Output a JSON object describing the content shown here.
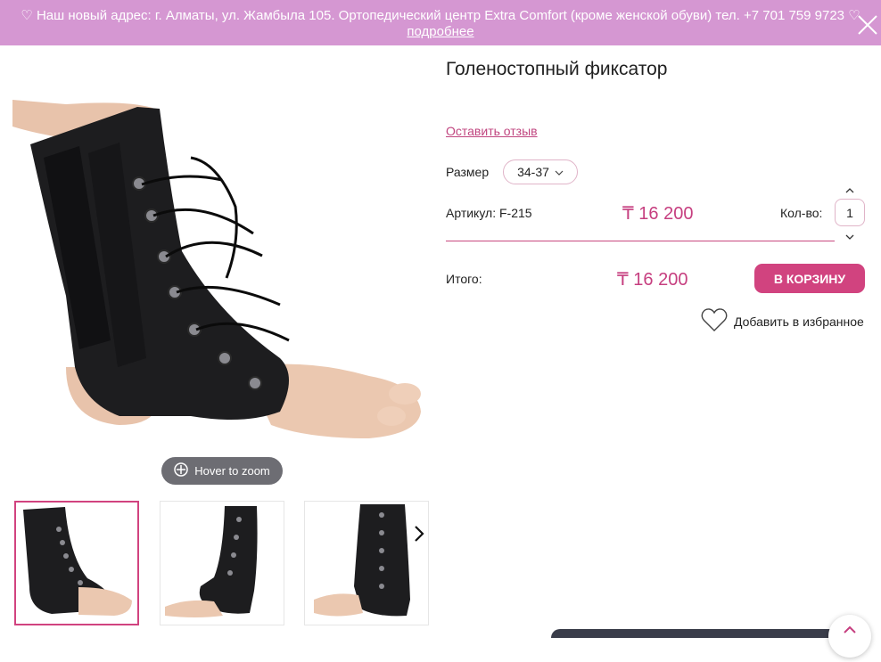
{
  "banner": {
    "message": "♡ Наш новый адрес: г. Алматы, ул. Жамбыла 105. Ортопедический центр Extra Comfort (кроме женской обуви) тел. +7 701 759 9723 ♡",
    "more_link": "подробнее"
  },
  "gallery": {
    "zoom_hint": "Hover to zoom"
  },
  "product": {
    "title": "Голеностопный фиксатор",
    "review_link": "Оставить отзыв",
    "size_label": "Размер",
    "size_value": "34-37",
    "article_label": "Артикул:",
    "article_value": "F-215",
    "price": "₸ 16 200",
    "qty_label": "Кол-во:",
    "qty_value": "1",
    "total_label": "Итого:",
    "total_price": "₸ 16 200",
    "cart_button": "В КОРЗИНУ",
    "favorite_label": "Добавить в избранное"
  },
  "colors": {
    "accent": "#d1437f",
    "banner_bg": "#d597d2"
  }
}
